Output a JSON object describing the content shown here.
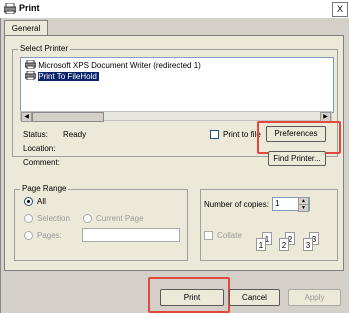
{
  "window": {
    "title": "Print",
    "close_glyph": "X"
  },
  "tabs": [
    {
      "label": "General"
    }
  ],
  "select_printer": {
    "label": "Select Printer",
    "printers": [
      {
        "name": "Microsoft XPS Document Writer (redirected 1)",
        "selected": false
      },
      {
        "name": "Print To FileHold",
        "selected": true
      }
    ]
  },
  "status": {
    "status_label": "Status:",
    "status_value": "Ready",
    "location_label": "Location:",
    "location_value": "",
    "comment_label": "Comment:",
    "comment_value": ""
  },
  "print_to_file": {
    "label": "Print to file",
    "checked": false
  },
  "buttons": {
    "preferences": "Preferences",
    "find_printer": "Find Printer...",
    "print": "Print",
    "cancel": "Cancel",
    "apply": "Apply"
  },
  "page_range": {
    "label": "Page Range",
    "all": "All",
    "selection": "Selection",
    "current_page": "Current Page",
    "pages": "Pages:",
    "pages_value": ""
  },
  "copies": {
    "label": "Number of copies:",
    "value": "1",
    "collate": "Collate",
    "collate_checked": false,
    "collate_pages": [
      "1",
      "1",
      "2",
      "2",
      "3",
      "3"
    ]
  },
  "scroll_arrows": {
    "left": "◀",
    "right": "▶",
    "up": "▲",
    "down": "▼"
  },
  "colors": {
    "highlight": "#e2483d",
    "selection": "#0a246a"
  }
}
